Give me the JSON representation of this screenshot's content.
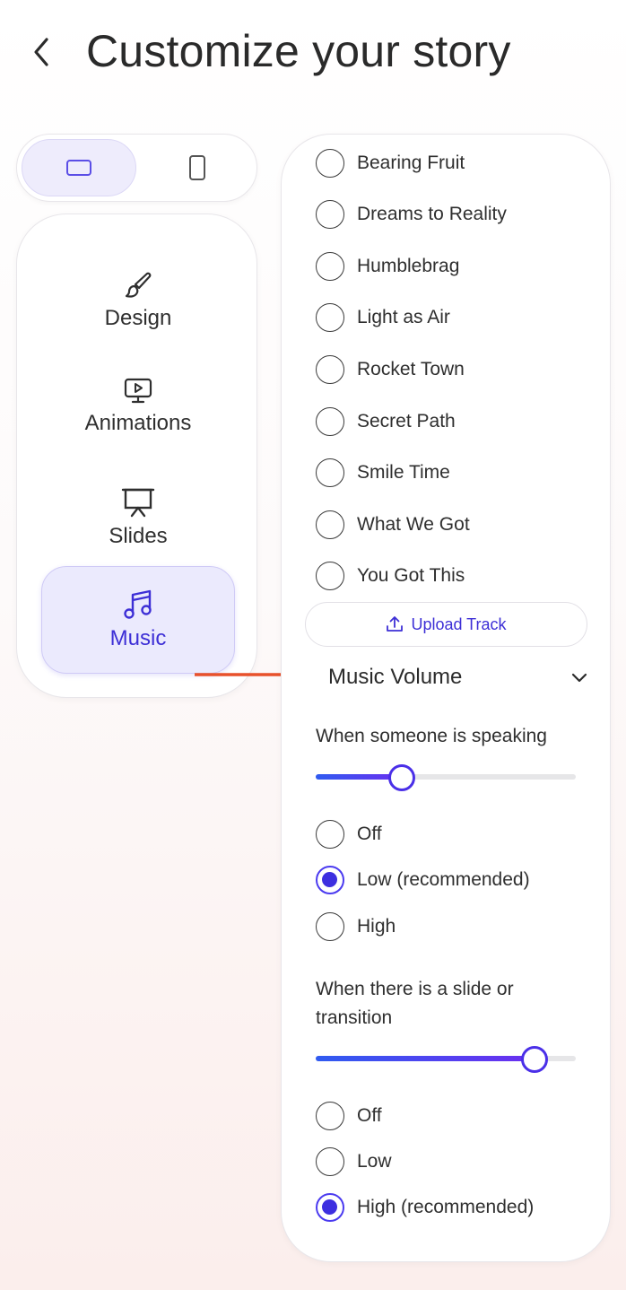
{
  "header": {
    "title": "Customize your story"
  },
  "device_toggle": {
    "selected": "landscape"
  },
  "nav": {
    "items": [
      {
        "label": "Design",
        "icon": "brush-icon"
      },
      {
        "label": "Animations",
        "icon": "monitor-play-icon"
      },
      {
        "label": "Slides",
        "icon": "presentation-icon"
      },
      {
        "label": "Music",
        "icon": "music-note-icon",
        "active": true
      }
    ]
  },
  "tracks": [
    {
      "label": "Bearing Fruit",
      "selected": false
    },
    {
      "label": "Dreams to Reality",
      "selected": false
    },
    {
      "label": "Humblebrag",
      "selected": false
    },
    {
      "label": "Light as Air",
      "selected": false
    },
    {
      "label": "Rocket Town",
      "selected": false
    },
    {
      "label": "Secret Path",
      "selected": false
    },
    {
      "label": "Smile Time",
      "selected": false
    },
    {
      "label": "What We Got",
      "selected": false
    },
    {
      "label": "You Got This",
      "selected": false
    }
  ],
  "upload": {
    "label": "Upload Track"
  },
  "volume": {
    "title": "Music Volume",
    "speaking": {
      "label": "When someone is speaking",
      "slider_fraction": 0.33,
      "options": [
        {
          "label": "Off",
          "selected": false
        },
        {
          "label": "Low (recommended)",
          "selected": true
        },
        {
          "label": "High",
          "selected": false
        }
      ]
    },
    "transition": {
      "label": "When there is a slide or transition",
      "slider_fraction": 0.84,
      "options": [
        {
          "label": "Off",
          "selected": false
        },
        {
          "label": "Low",
          "selected": false
        },
        {
          "label": "High (recommended)",
          "selected": true
        }
      ]
    }
  },
  "colors": {
    "accent": "#3d2fd6",
    "arrow": "#e8512b",
    "active_bg": "#ebeafd"
  }
}
